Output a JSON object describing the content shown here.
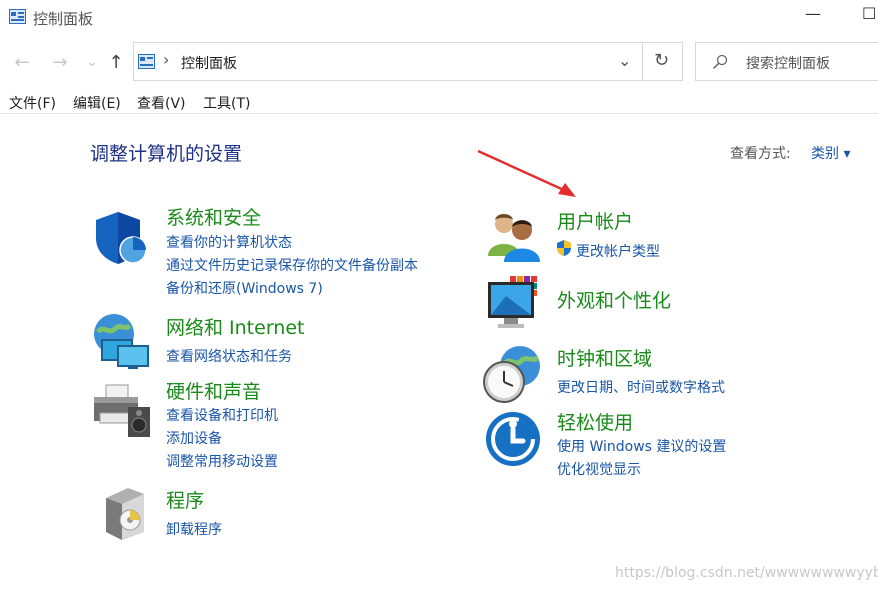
{
  "window": {
    "title": "控制面板",
    "minimize": "—",
    "maximize": "☐"
  },
  "nav": {
    "back": "←",
    "forward": "→",
    "recent": "⌄",
    "up": "↑"
  },
  "address": {
    "chevron": "›",
    "path": "控制面板",
    "dropdown": "⌄",
    "refresh": "↻"
  },
  "search": {
    "placeholder": "搜索控制面板"
  },
  "menu": [
    "文件(F)",
    "编辑(E)",
    "查看(V)",
    "工具(T)"
  ],
  "page": {
    "title": "调整计算机的设置",
    "view_by_label": "查看方式:",
    "view_by_value": "类别 ▾"
  },
  "categories": {
    "system": {
      "title": "系统和安全",
      "links": [
        "查看你的计算机状态",
        "通过文件历史记录保存你的文件备份副本",
        "备份和还原(Windows 7)"
      ]
    },
    "network": {
      "title": "网络和 Internet",
      "links": [
        "查看网络状态和任务"
      ]
    },
    "hardware": {
      "title": "硬件和声音",
      "links": [
        "查看设备和打印机",
        "添加设备",
        "调整常用移动设置"
      ]
    },
    "programs": {
      "title": "程序",
      "links": [
        "卸载程序"
      ]
    },
    "accounts": {
      "title": "用户帐户",
      "links": [
        "更改帐户类型"
      ]
    },
    "appearance": {
      "title": "外观和个性化",
      "links": []
    },
    "clock": {
      "title": "时钟和区域",
      "links": [
        "更改日期、时间或数字格式"
      ]
    },
    "ease": {
      "title": "轻松使用",
      "links": [
        "使用 Windows 建议的设置",
        "优化视觉显示"
      ]
    }
  },
  "watermark": "https://blog.csdn.net/wwwwwwwwyyb",
  "colors": {
    "category_title": "#1a8a1a",
    "link": "#1a56a8",
    "page_title": "#1e3287",
    "arrow": "#e52b2b"
  }
}
